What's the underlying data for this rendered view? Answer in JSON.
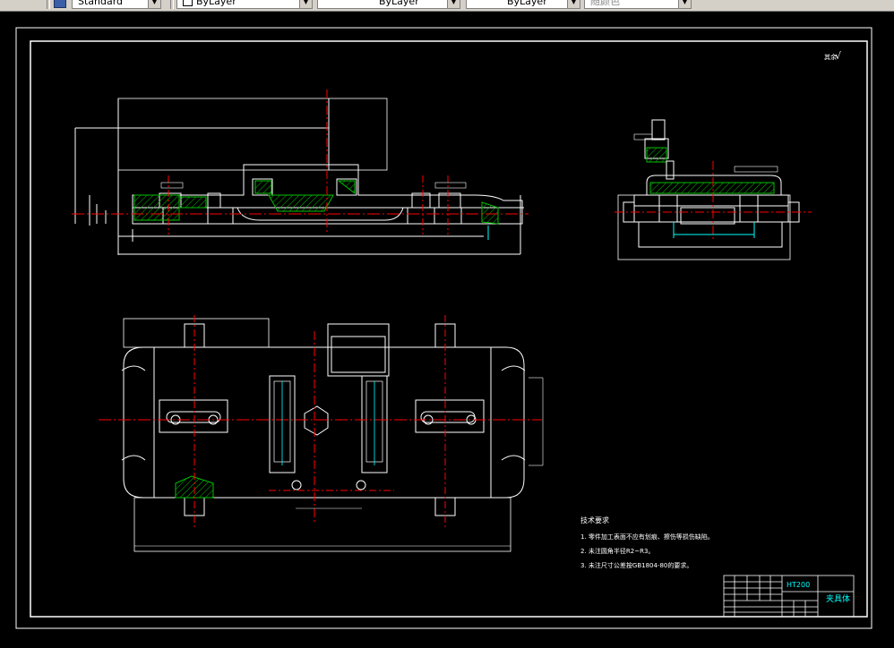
{
  "toolbar": {
    "text_style": "Standard",
    "layer_color": "ByLayer",
    "linetype": "ByLayer",
    "lineweight": "ByLayer",
    "plot_style": "随颜色"
  },
  "drawing": {
    "roughness_symbol": "√",
    "roughness_prefix": "其余",
    "tech_title": "技术要求",
    "tech_notes": [
      "1. 零件加工表面不应有划痕、擦伤等损伤缺陷。",
      "2. 未注圆角半径R2~R3。",
      "3. 未注尺寸公差按GB1804-80的要求。"
    ],
    "material": "HT200",
    "part_name": "夹具体"
  },
  "colors": {
    "background": "#000000",
    "line": "#ffffff",
    "center": "#ff0000",
    "hatch": "#00c000",
    "dimension": "#00ffff"
  }
}
